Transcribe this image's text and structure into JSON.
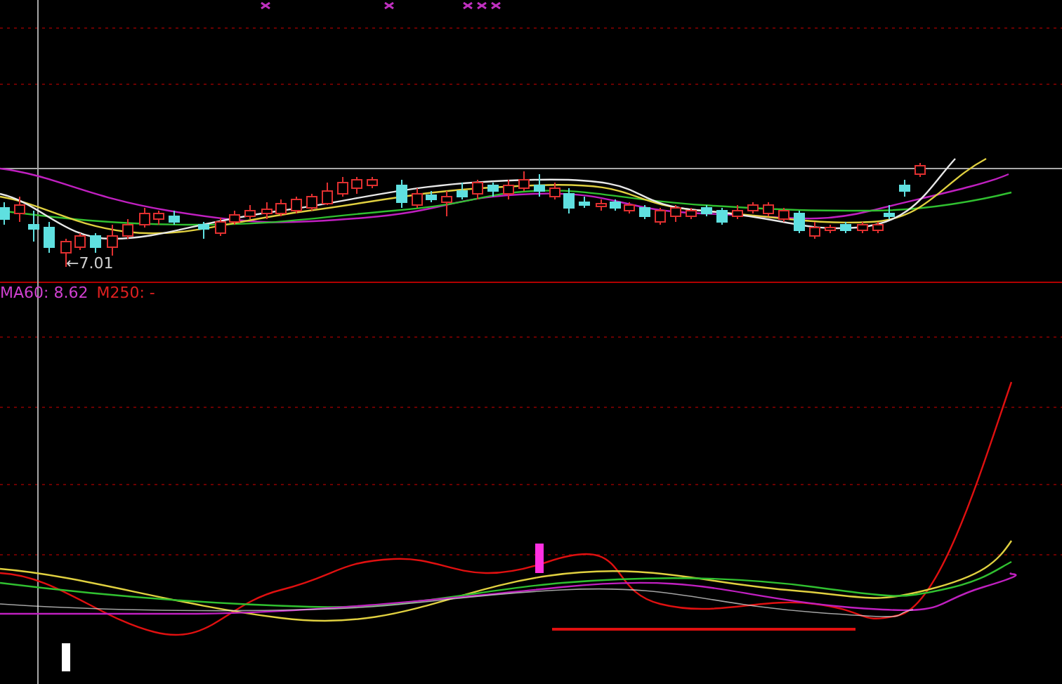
{
  "price_panel": {
    "low_marker": "←7.01"
  },
  "legend": [
    {
      "text": "MA60: 8.62",
      "color": "#d040d0"
    },
    {
      "text": "M250: -",
      "color": "#e02020"
    }
  ]
}
